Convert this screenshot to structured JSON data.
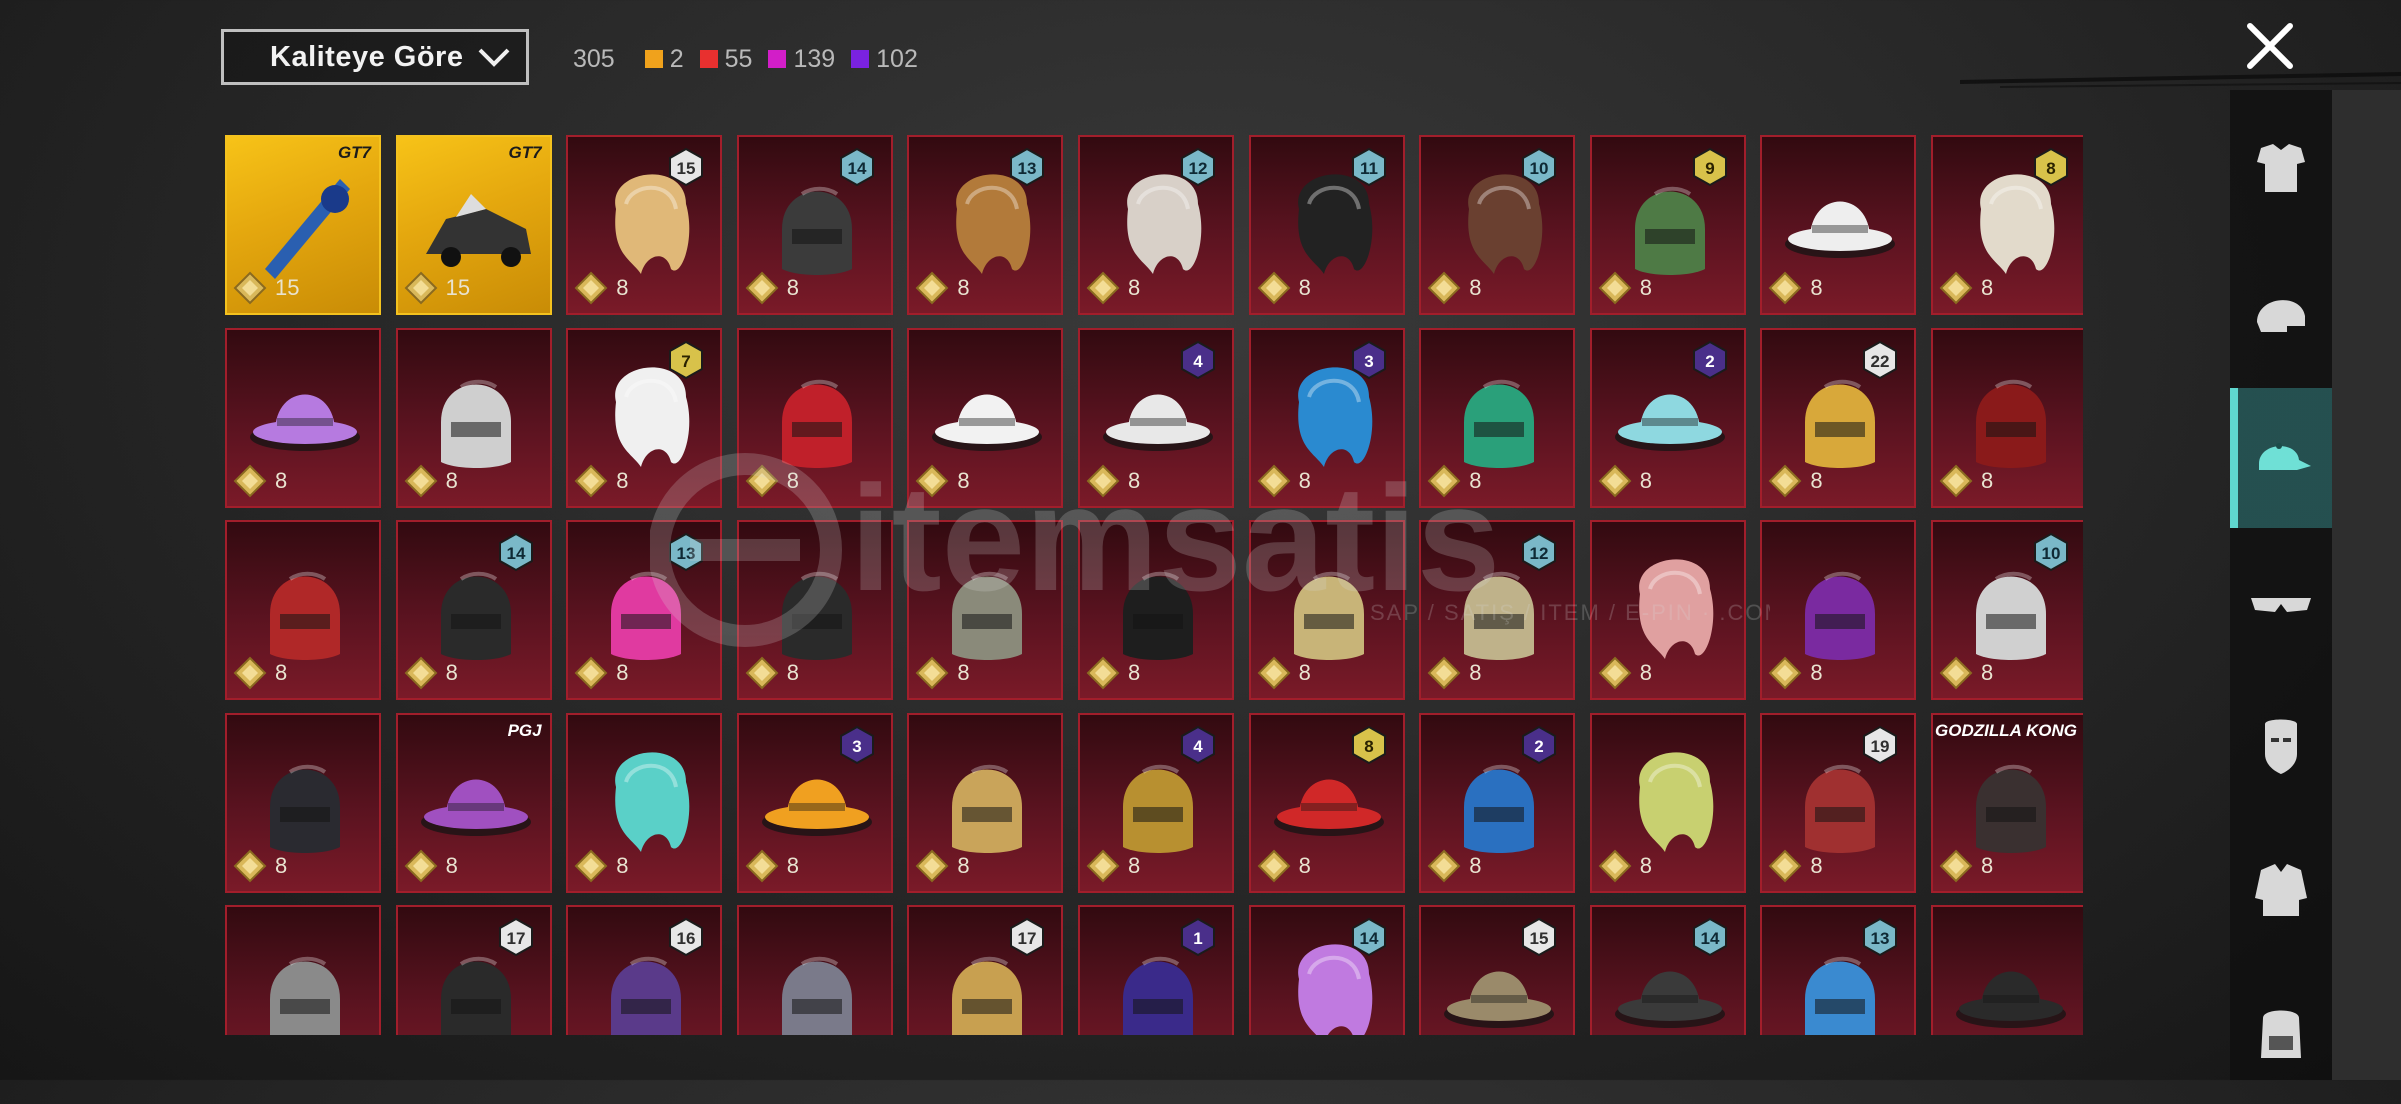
{
  "header": {
    "sort_label": "Kaliteye Göre",
    "total_count": "305",
    "quality_counts": [
      {
        "color": "#f0a21c",
        "count": "2"
      },
      {
        "color": "#e8302f",
        "count": "55"
      },
      {
        "color": "#d21ec8",
        "count": "139"
      },
      {
        "color": "#7a22e0",
        "count": "102"
      }
    ]
  },
  "watermark": {
    "brand": "itemsatis",
    "tagline": "SAP / SATIŞ / ITEM / E-PIN · .COM"
  },
  "sidebar": {
    "categories": [
      {
        "icon": "outfit-icon",
        "active": false
      },
      {
        "icon": "helmet-icon",
        "active": false
      },
      {
        "icon": "cap-icon",
        "active": true
      },
      {
        "icon": "glasses-icon",
        "active": false
      },
      {
        "icon": "mask-icon",
        "active": false
      },
      {
        "icon": "jacket-icon",
        "active": false
      },
      {
        "icon": "backpack-icon",
        "active": false
      }
    ]
  },
  "items": [
    {
      "price": "15",
      "tier": "",
      "brand": "GT7",
      "quality": "gold",
      "icon": "weapon-skin-icon",
      "color": "#2a5fb0"
    },
    {
      "price": "15",
      "tier": "",
      "brand": "GT7",
      "quality": "gold",
      "icon": "vehicle-skin-icon",
      "color": "#333333"
    },
    {
      "price": "8",
      "tier": "15",
      "brand": "",
      "quality": "red",
      "icon": "hair-icon",
      "color": "#e0b878"
    },
    {
      "price": "8",
      "tier": "14",
      "brand": "",
      "quality": "red",
      "icon": "mask-hood-icon",
      "color": "#3b3b3b"
    },
    {
      "price": "8",
      "tier": "13",
      "brand": "",
      "quality": "red",
      "icon": "hat-hair-icon",
      "color": "#b27a3a"
    },
    {
      "price": "8",
      "tier": "12",
      "brand": "",
      "quality": "red",
      "icon": "hair-icon",
      "color": "#d8d0c8"
    },
    {
      "price": "8",
      "tier": "11",
      "brand": "",
      "quality": "red",
      "icon": "hair-icon",
      "color": "#222222"
    },
    {
      "price": "8",
      "tier": "10",
      "brand": "",
      "quality": "red",
      "icon": "hair-icon",
      "color": "#6a4030"
    },
    {
      "price": "8",
      "tier": "9",
      "brand": "",
      "quality": "red",
      "icon": "head-icon",
      "color": "#4e7a45"
    },
    {
      "price": "8",
      "tier": "",
      "brand": "",
      "quality": "red",
      "icon": "cowboy-hat-icon",
      "color": "#eeeeee"
    },
    {
      "price": "8",
      "tier": "8",
      "brand": "",
      "quality": "red",
      "icon": "hair-icon",
      "color": "#e2dacb"
    },
    {
      "price": "8",
      "tier": "",
      "brand": "",
      "quality": "red",
      "icon": "jellyfish-hat-icon",
      "color": "#b67ae0"
    },
    {
      "price": "8",
      "tier": "",
      "brand": "",
      "quality": "red",
      "icon": "fox-mask-icon",
      "color": "#cfcfcf"
    },
    {
      "price": "8",
      "tier": "7",
      "brand": "",
      "quality": "red",
      "icon": "hair-icon",
      "color": "#f0f0f0"
    },
    {
      "price": "8",
      "tier": "",
      "brand": "",
      "quality": "red",
      "icon": "helmet-icon",
      "color": "#c0202a"
    },
    {
      "price": "8",
      "tier": "",
      "brand": "",
      "quality": "red",
      "icon": "panda-hat-icon",
      "color": "#f2f2f2"
    },
    {
      "price": "8",
      "tier": "4",
      "brand": "",
      "quality": "red",
      "icon": "snowman-hat-icon",
      "color": "#e8e8e8"
    },
    {
      "price": "8",
      "tier": "3",
      "brand": "",
      "quality": "red",
      "icon": "clown-wig-icon",
      "color": "#2a8ad0"
    },
    {
      "price": "8",
      "tier": "",
      "brand": "",
      "quality": "red",
      "icon": "dragon-helmet-icon",
      "color": "#2aa07a"
    },
    {
      "price": "8",
      "tier": "2",
      "brand": "",
      "quality": "red",
      "icon": "bucket-hat-icon",
      "color": "#8ed8e0"
    },
    {
      "price": "8",
      "tier": "22",
      "brand": "",
      "quality": "red",
      "icon": "golden-helmet-icon",
      "color": "#d8a83a"
    },
    {
      "price": "8",
      "tier": "",
      "brand": "",
      "quality": "red",
      "icon": "oni-mask-icon",
      "color": "#8a1a1a"
    },
    {
      "price": "8",
      "tier": "",
      "brand": "",
      "quality": "red",
      "icon": "helmet-icon",
      "color": "#b02828"
    },
    {
      "price": "8",
      "tier": "14",
      "brand": "",
      "quality": "red",
      "icon": "pharaoh-hood-icon",
      "color": "#2a2a2a"
    },
    {
      "price": "8",
      "tier": "13",
      "brand": "",
      "quality": "red",
      "icon": "dreadlock-mask-icon",
      "color": "#e03aa0"
    },
    {
      "price": "8",
      "tier": "",
      "brand": "",
      "quality": "red",
      "icon": "hood-icon",
      "color": "#2a2a2a"
    },
    {
      "price": "8",
      "tier": "",
      "brand": "",
      "quality": "red",
      "icon": "knight-helmet-icon",
      "color": "#8a8a7a"
    },
    {
      "price": "8",
      "tier": "",
      "brand": "",
      "quality": "red",
      "icon": "hood-icon",
      "color": "#1e1e1e"
    },
    {
      "price": "8",
      "tier": "",
      "brand": "",
      "quality": "red",
      "icon": "anubis-helmet-icon",
      "color": "#c8b478"
    },
    {
      "price": "8",
      "tier": "12",
      "brand": "",
      "quality": "red",
      "icon": "winged-helmet-icon",
      "color": "#bfb28a"
    },
    {
      "price": "8",
      "tier": "",
      "brand": "",
      "quality": "red",
      "icon": "hair-icon",
      "color": "#e0a0a0"
    },
    {
      "price": "8",
      "tier": "",
      "brand": "",
      "quality": "red",
      "icon": "purple-helmet-icon",
      "color": "#7a2aa0"
    },
    {
      "price": "8",
      "tier": "10",
      "brand": "",
      "quality": "red",
      "icon": "bird-head-icon",
      "color": "#d0d0d0"
    },
    {
      "price": "8",
      "tier": "",
      "brand": "",
      "quality": "red",
      "icon": "bat-helmet-icon",
      "color": "#2a2a30"
    },
    {
      "price": "8",
      "tier": "",
      "brand": "PGJ",
      "quality": "red",
      "icon": "jester-hat-icon",
      "color": "#a050c0"
    },
    {
      "price": "8",
      "tier": "",
      "brand": "",
      "quality": "red",
      "icon": "hair-icon",
      "color": "#5ad0c8"
    },
    {
      "price": "8",
      "tier": "3",
      "brand": "",
      "quality": "red",
      "icon": "fries-hat-icon",
      "color": "#f0a020"
    },
    {
      "price": "8",
      "tier": "",
      "brand": "",
      "quality": "red",
      "icon": "gold-dragon-helmet-icon",
      "color": "#c9a45a"
    },
    {
      "price": "8",
      "tier": "4",
      "brand": "",
      "quality": "red",
      "icon": "gold-helmet-icon",
      "color": "#b89030"
    },
    {
      "price": "8",
      "tier": "8",
      "brand": "",
      "quality": "red",
      "icon": "red-hat-icon",
      "color": "#d02828"
    },
    {
      "price": "8",
      "tier": "2",
      "brand": "",
      "quality": "red",
      "icon": "blue-helmet-icon",
      "color": "#2a70c0"
    },
    {
      "price": "8",
      "tier": "",
      "brand": "",
      "quality": "red",
      "icon": "hair-icon",
      "color": "#c8d070"
    },
    {
      "price": "8",
      "tier": "19",
      "brand": "",
      "quality": "red",
      "icon": "samurai-helmet-icon",
      "color": "#a03030"
    },
    {
      "price": "8",
      "tier": "",
      "brand": "GODZILLA KONG",
      "quality": "red",
      "icon": "ape-head-icon",
      "color": "#3a3030"
    },
    {
      "price": "",
      "tier": "",
      "brand": "",
      "quality": "red",
      "icon": "helmet-icon",
      "color": "#8a8a8a"
    },
    {
      "price": "",
      "tier": "17",
      "brand": "",
      "quality": "red",
      "icon": "scorpion-helmet-icon",
      "color": "#2a2a2a"
    },
    {
      "price": "",
      "tier": "16",
      "brand": "",
      "quality": "red",
      "icon": "cyber-helmet-icon",
      "color": "#5a3a8a"
    },
    {
      "price": "",
      "tier": "",
      "brand": "",
      "quality": "red",
      "icon": "mech-helmet-icon",
      "color": "#7a7a8a"
    },
    {
      "price": "",
      "tier": "17",
      "brand": "",
      "quality": "red",
      "icon": "gold-crown-helmet-icon",
      "color": "#c8a050"
    },
    {
      "price": "",
      "tier": "1",
      "brand": "",
      "quality": "red",
      "icon": "blue-mask-icon",
      "color": "#3a2a8a"
    },
    {
      "price": "",
      "tier": "14",
      "brand": "",
      "quality": "red",
      "icon": "purple-wig-icon",
      "color": "#c07ae0"
    },
    {
      "price": "",
      "tier": "15",
      "brand": "",
      "quality": "red",
      "icon": "pickaxe-hat-icon",
      "color": "#9a8a6a"
    },
    {
      "price": "",
      "tier": "14",
      "brand": "",
      "quality": "red",
      "icon": "officer-cap-icon",
      "color": "#3a3a3a"
    },
    {
      "price": "",
      "tier": "13",
      "brand": "",
      "quality": "red",
      "icon": "robot-helmet-icon",
      "color": "#3a8ad0"
    },
    {
      "price": "",
      "tier": "",
      "brand": "",
      "quality": "red",
      "icon": "pirate-hat-icon",
      "color": "#2a2a2a"
    }
  ]
}
